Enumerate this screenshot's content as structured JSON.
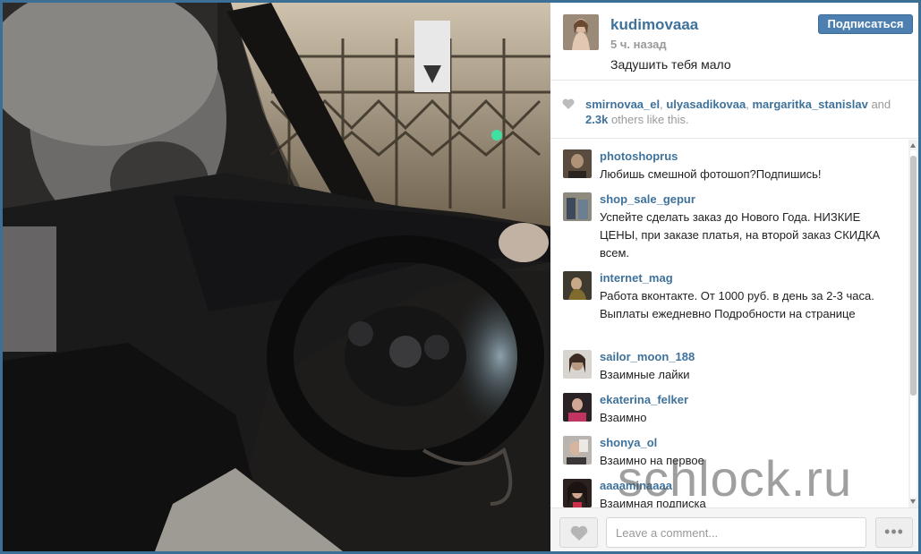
{
  "post": {
    "username": "kudimovaaa",
    "time": "5 ч. назад",
    "caption": "Задушить тебя мало",
    "follow_label": "Подписаться"
  },
  "likes": {
    "users": [
      "smirnovaa_el",
      "ulyasadikovaa",
      "margaritka_stanislav"
    ],
    "sep": ", ",
    "and": "and",
    "count": "2.3k",
    "rest": "others like this."
  },
  "comments": [
    {
      "user": "photoshoprus",
      "text": "Любишь смешной фотошоп?Подпишись!"
    },
    {
      "user": "shop_sale_gepur",
      "text": "Успейте сделать заказ до Нового Года. НИЗКИЕ ЦЕНЫ, при заказе платья, на второй заказ СКИДКА всем."
    },
    {
      "user": "internet_mag",
      "text": "Работа вконтакте. От 1000 руб. в день за 2-3 часа. Выплаты ежедневно Подробности на странице"
    },
    {
      "user": "sailor_moon_188",
      "text": "Взаимные лайки"
    },
    {
      "user": "ekaterina_felker",
      "text": "Взаимно"
    },
    {
      "user": "shonya_ol",
      "text": "Взаимно на первое"
    },
    {
      "user": "aaaaminaaaa",
      "text": "Взаимная подписка"
    }
  ],
  "footer": {
    "placeholder": "Leave a comment...",
    "more_label": "•••"
  },
  "watermark": "schlock.ru",
  "icons": {
    "like": "heart-icon",
    "more": "more-options-icon"
  },
  "colors": {
    "link": "#3f729b",
    "follow": "#4d7fb0",
    "frame": "#3b6f95"
  }
}
